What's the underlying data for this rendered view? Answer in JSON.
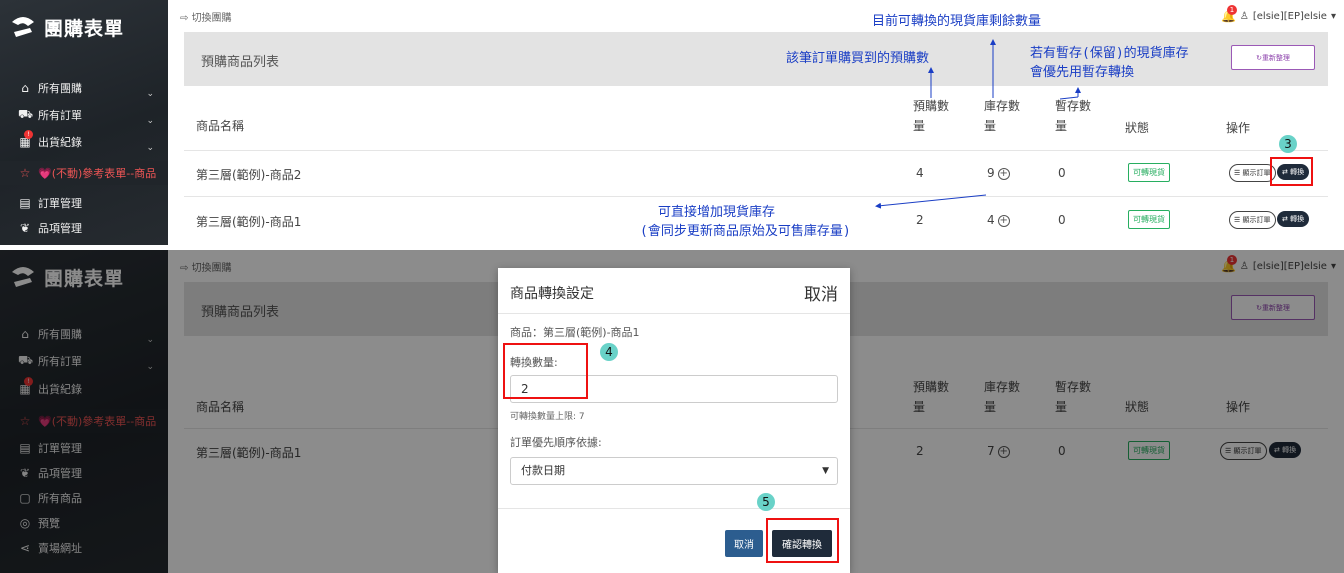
{
  "app": {
    "brand": "團購表單"
  },
  "topbar": {
    "switch": "切換團購",
    "user": "[elsie][EP]elsie",
    "notif_count": "1"
  },
  "sidebar": {
    "items": [
      {
        "label": "所有團購",
        "icon": "home-icon"
      },
      {
        "label": "所有訂單",
        "icon": "cart-icon"
      },
      {
        "label": "出貨紀錄",
        "icon": "truck-icon"
      },
      {
        "label": "💗(不動)參考表單--商品",
        "icon": "star-icon"
      },
      {
        "label": "訂單管理",
        "icon": "clipboard-icon"
      },
      {
        "label": "品項管理",
        "icon": "gift-icon"
      },
      {
        "label": "所有商品",
        "icon": "box-icon"
      },
      {
        "label": "預覽",
        "icon": "eye-icon"
      },
      {
        "label": "賣場網址",
        "icon": "share-icon"
      }
    ]
  },
  "list": {
    "title": "預購商品列表",
    "refresh": "重新整理",
    "headers": {
      "name": "商品名稱",
      "preorder": "預購數量",
      "stock": "庫存數量",
      "hold": "暫存數量",
      "status": "狀態",
      "ops": "操作"
    },
    "rows_top": [
      {
        "name": "第三層(範例)-商品2",
        "preorder": "4",
        "stock": "9",
        "hold": "0",
        "status": "可轉現貨"
      },
      {
        "name": "第三層(範例)-商品1",
        "preorder": "2",
        "stock": "4",
        "hold": "0",
        "status": "可轉現貨"
      }
    ],
    "rows_bottom": [
      {
        "name": "第三層(範例)-商品1",
        "preorder": "2",
        "stock": "7",
        "hold": "0",
        "status": "可轉現貨"
      }
    ],
    "btn_orders": "顯示訂單",
    "btn_convert": "轉換"
  },
  "annotations": {
    "stock_remaining": "目前可轉換的現貨庫剩餘數量",
    "preorder_qty": "該筆訂單購買到的預購數",
    "hold_line1": "若有暫存(保留)的現貨庫存",
    "hold_line2": "會優先用暫存轉換",
    "add_stock_line1": "可直接增加現貨庫存",
    "add_stock_line2": "(會同步更新商品原始及可售庫存量)",
    "step3": "3",
    "step4": "4",
    "step5": "5"
  },
  "modal": {
    "title": "商品轉換設定",
    "close": "取消",
    "product": "商品：第三層(範例)-商品1",
    "qty_label": "轉換數量:",
    "qty_value": "2",
    "qty_hint": "可轉換數量上限: 7",
    "priority_label": "訂單優先順序依據:",
    "priority_value": "付款日期",
    "cancel": "取消",
    "confirm": "確認轉換"
  },
  "colors": {
    "annotation": "#1a3ec5",
    "highlight": "#ee1111",
    "step": "#69d2c8"
  }
}
